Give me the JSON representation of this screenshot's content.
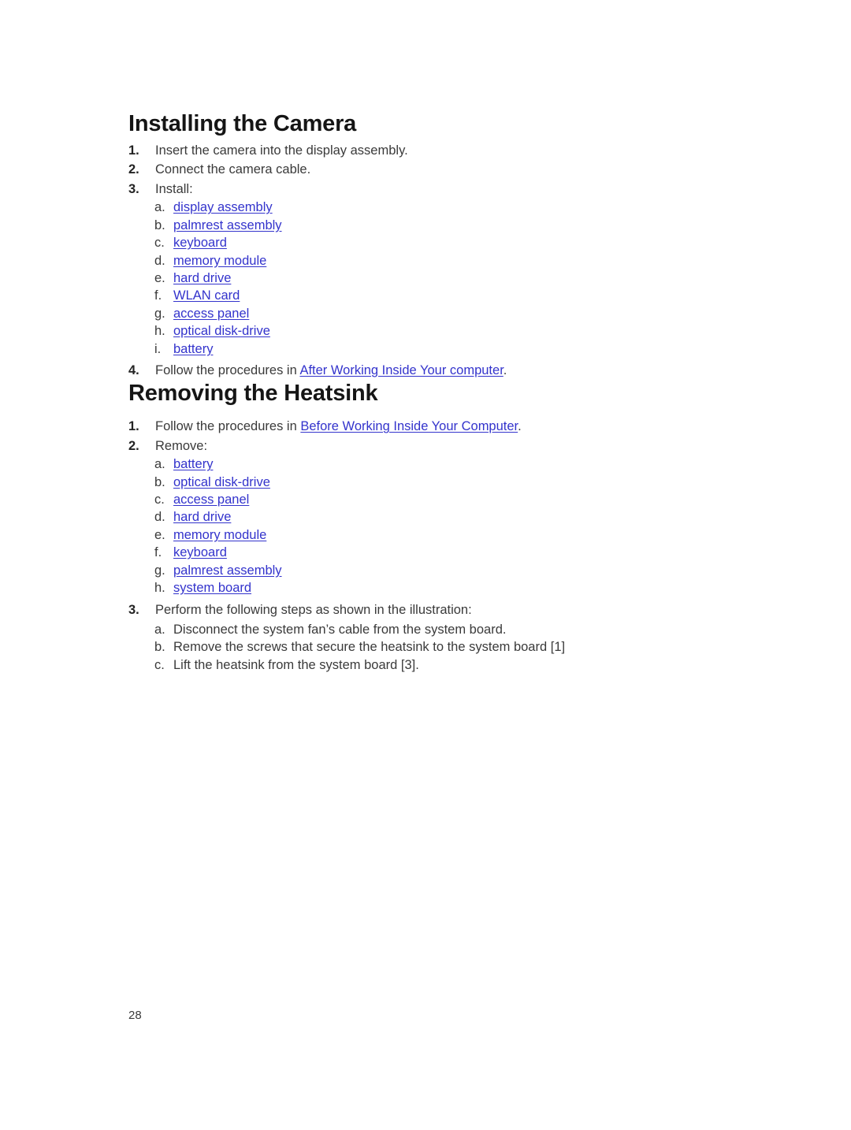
{
  "page": {
    "number": "28",
    "background": "#ffffff",
    "text_color": "#3a3a3a",
    "heading_color": "#151515",
    "link_color": "#3333cc"
  },
  "sections": [
    {
      "heading": "Installing the Camera",
      "steps": [
        {
          "num": "1.",
          "text": "Insert the camera into the display assembly."
        },
        {
          "num": "2.",
          "text": "Connect the camera cable."
        },
        {
          "num": "3.",
          "text": "Install:"
        }
      ],
      "substeps": [
        {
          "marker": "a.",
          "label": "display assembly"
        },
        {
          "marker": "b.",
          "label": "palmrest assembly"
        },
        {
          "marker": "c.",
          "label": "keyboard"
        },
        {
          "marker": "d.",
          "label": "memory module"
        },
        {
          "marker": "e.",
          "label": "hard drive"
        },
        {
          "marker": "f.",
          "label": "WLAN card"
        },
        {
          "marker": "g.",
          "label": "access panel"
        },
        {
          "marker": "h.",
          "label": "optical disk-drive"
        },
        {
          "marker": "i.",
          "label": "battery"
        }
      ],
      "final_step": {
        "num": "4.",
        "prefix": "Follow the procedures in ",
        "link": "After Working Inside Your computer",
        "suffix": "."
      }
    },
    {
      "heading": "Removing the Heatsink",
      "first_step": {
        "num": "1.",
        "prefix": "Follow the procedures in ",
        "link": "Before Working Inside Your Computer",
        "suffix": "."
      },
      "remove_step": {
        "num": "2.",
        "text": "Remove:"
      },
      "substeps": [
        {
          "marker": "a.",
          "label": "battery"
        },
        {
          "marker": "b.",
          "label": "optical disk-drive"
        },
        {
          "marker": "c.",
          "label": "access panel"
        },
        {
          "marker": "d.",
          "label": "hard drive"
        },
        {
          "marker": "e.",
          "label": "memory module"
        },
        {
          "marker": "f.",
          "label": "keyboard"
        },
        {
          "marker": "g.",
          "label": "palmrest assembly"
        },
        {
          "marker": "h.",
          "label": "system board"
        }
      ],
      "perform_step": {
        "num": "3.",
        "text": "Perform the following steps as shown in the illustration:"
      },
      "perform_substeps": [
        {
          "marker": "a.",
          "text": "Disconnect the system fan’s cable from the system board."
        },
        {
          "marker": "b.",
          "text": "Remove the screws that secure the heatsink to the system board [1]"
        },
        {
          "marker": "c.",
          "text": "Lift the heatsink from the system board [3]."
        }
      ]
    }
  ]
}
